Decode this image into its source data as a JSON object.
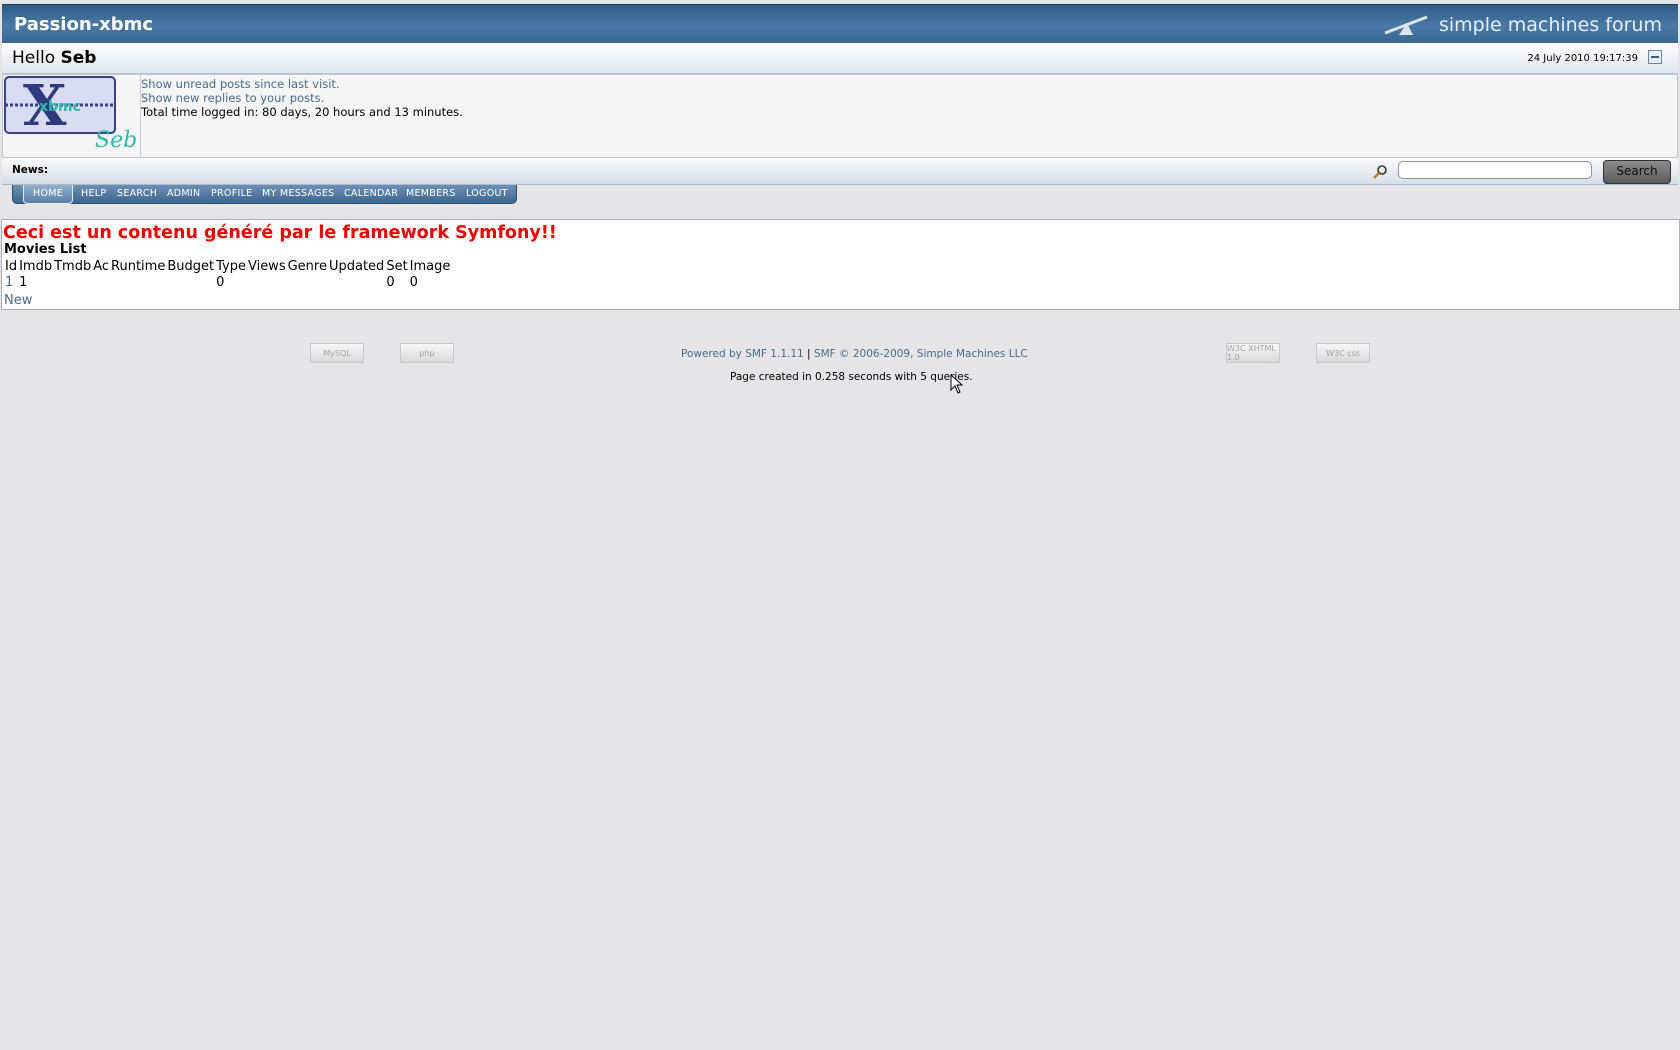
{
  "header": {
    "forum_title": "Passion-xbmc",
    "smf_logo_text": "simple machines forum"
  },
  "userbar": {
    "hello_prefix": "Hello",
    "username": "Seb",
    "datetime": "24 July 2010 19:17:39"
  },
  "userinfo": {
    "unread_link": "Show unread posts since last visit.",
    "replies_link": "Show new replies to your posts.",
    "time_logged": "Total time logged in: 80 days, 20 hours and 13 minutes.",
    "avatar_text": "Seb"
  },
  "newsbar": {
    "label": "News:",
    "search_value": "",
    "search_button": "Search"
  },
  "menu": {
    "items": [
      "HOME",
      "HELP",
      "SEARCH",
      "ADMIN",
      "PROFILE",
      "MY MESSAGES",
      "CALENDAR",
      "MEMBERS",
      "LOGOUT"
    ],
    "active": "HOME"
  },
  "content": {
    "heading": "Ceci est un contenu généré par le framework Symfony!!",
    "list_title": "Movies List",
    "columns": [
      "Id",
      "Imdb",
      "Tmdb",
      "Ac",
      "Runtime",
      "Budget",
      "Type",
      "Views",
      "Genre",
      "Updated",
      "Set",
      "Image"
    ],
    "rows": [
      [
        "1",
        "1",
        "",
        "",
        "",
        "",
        "0",
        "",
        "",
        "",
        "0",
        "0"
      ]
    ],
    "new_link": "New"
  },
  "footer": {
    "powered_by": "Powered by SMF 1.1.11",
    "separator": "|",
    "copyright": "SMF © 2006-2009, Simple Machines LLC",
    "page_created": "Page created in 0.258 seconds with 5 queries.",
    "badges": {
      "mysql": "MySQL",
      "php": "php",
      "xhtml": "W3C XHTML 1.0",
      "css": "W3C css"
    }
  }
}
